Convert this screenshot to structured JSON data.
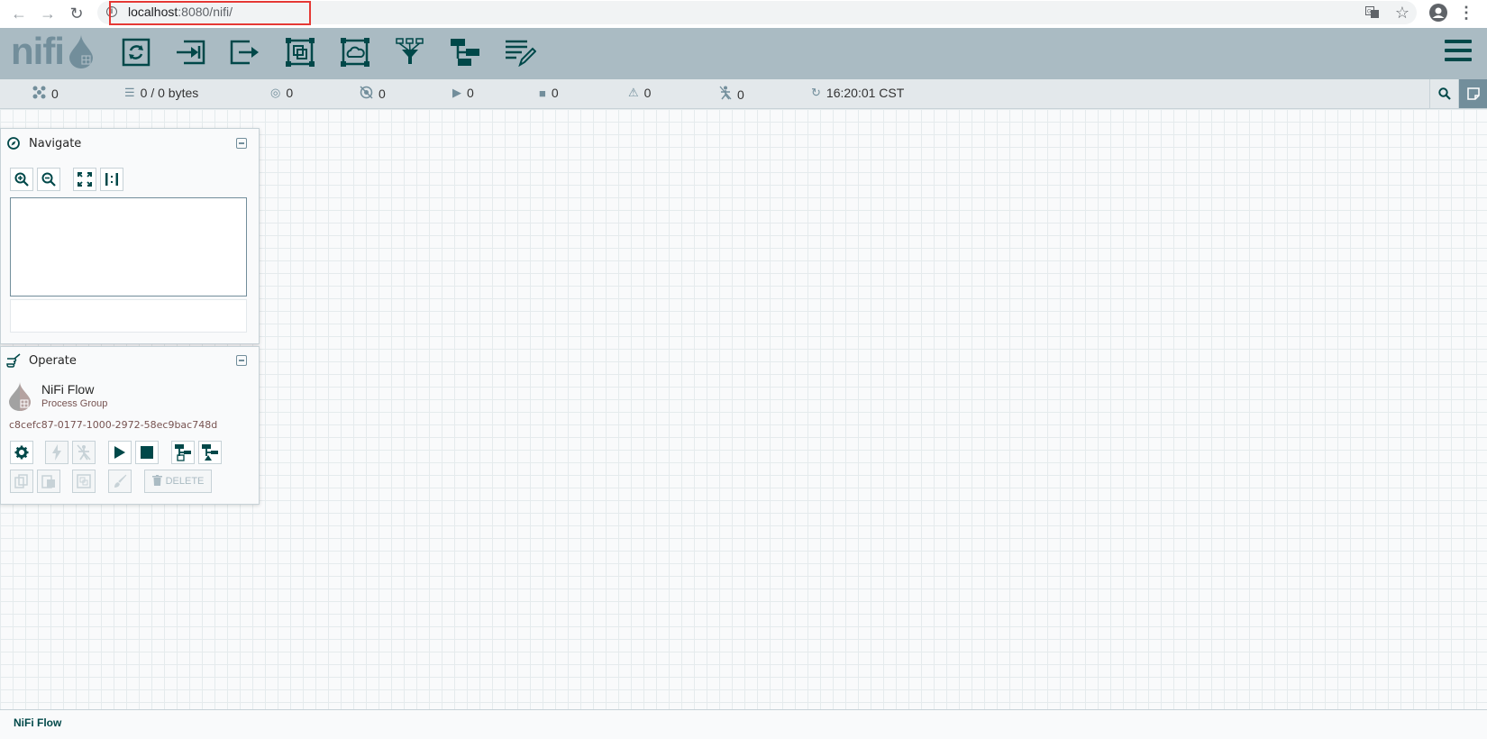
{
  "browser": {
    "url_host": "localhost",
    "url_rest": ":8080/nifi/"
  },
  "header": {
    "logo": "nifi",
    "toolbar": [
      "processor-icon",
      "input-port-icon",
      "output-port-icon",
      "process-group-icon",
      "remote-process-group-icon",
      "funnel-icon",
      "template-icon",
      "label-icon"
    ]
  },
  "status": {
    "threads": "0",
    "queued": "0 / 0 bytes",
    "transmitting": "0",
    "not_transmitting": "0",
    "running": "0",
    "stopped": "0",
    "invalid": "0",
    "disabled": "0",
    "refresh_time": "16:20:01 CST"
  },
  "navigate": {
    "title": "Navigate"
  },
  "operate": {
    "title": "Operate",
    "name": "NiFi Flow",
    "type": "Process Group",
    "id": "c8cefc87-0177-1000-2972-58ec9bac748d",
    "delete_label": "DELETE"
  },
  "footer": {
    "breadcrumb": "NiFi Flow"
  },
  "colors": {
    "header": "#aabbc3",
    "accent": "#004849",
    "status_bar": "#e3e8eb"
  }
}
